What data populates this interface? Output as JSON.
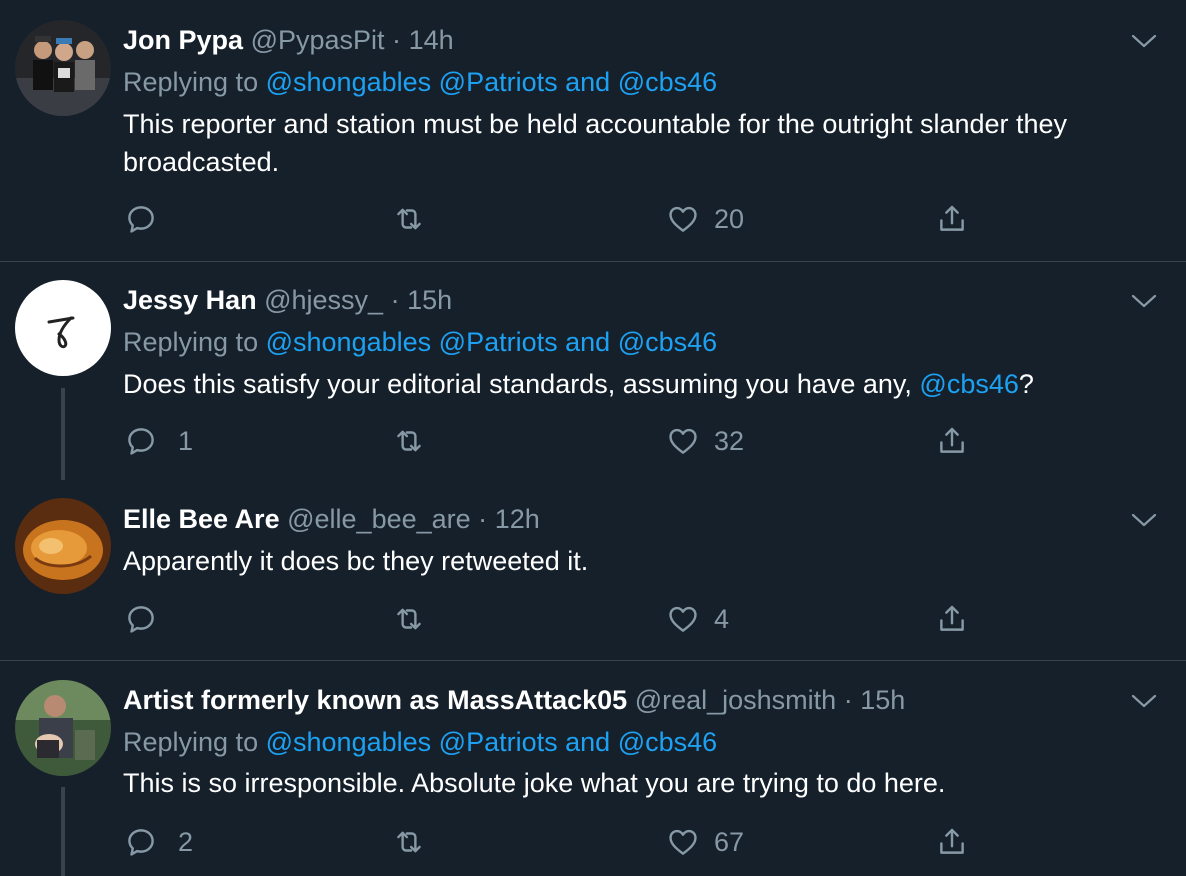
{
  "tweets": [
    {
      "name": "Jon Pypa",
      "handle": "@PypasPit",
      "dot": "·",
      "time": "14h",
      "replying_prefix": "Replying to",
      "mention1": "@shongables",
      "mention2": "@Patriots",
      "and": "and",
      "mention3": "@cbs46",
      "text": "This reporter and station must be held accountable for the outright slander they broadcasted.",
      "replies": "",
      "likes": "20"
    },
    {
      "name": "Jessy Han",
      "handle": "@hjessy_",
      "dot": "·",
      "time": "15h",
      "replying_prefix": "Replying to",
      "mention1": "@shongables",
      "mention2": "@Patriots",
      "and": "and",
      "mention3": "@cbs46",
      "text_before": "Does this satisfy your editorial standards, assuming you have any, ",
      "text_mention": "@cbs46",
      "text_after": "?",
      "replies": "1",
      "likes": "32"
    },
    {
      "name": "Elle Bee Are",
      "handle": "@elle_bee_are",
      "dot": "·",
      "time": "12h",
      "text": "Apparently it does bc they retweeted it.",
      "replies": "",
      "likes": "4"
    },
    {
      "name": "Artist formerly known as MassAttack05",
      "handle": "@real_joshsmith",
      "dot": "·",
      "time": "15h",
      "replying_prefix": "Replying to",
      "mention1": "@shongables",
      "mention2": "@Patriots",
      "and": "and",
      "mention3": "@cbs46",
      "text": "This is so irresponsible. Absolute joke what you are trying to do here.",
      "replies": "2",
      "likes": "67"
    }
  ],
  "colors": {
    "background": "#15202b",
    "secondary_text": "#8899a6",
    "link": "#1da1f2",
    "divider": "#38444d"
  },
  "icons": {
    "reply": "reply-icon",
    "retweet": "retweet-icon",
    "like": "like-icon",
    "share": "share-icon",
    "more": "chevron-down-icon"
  }
}
